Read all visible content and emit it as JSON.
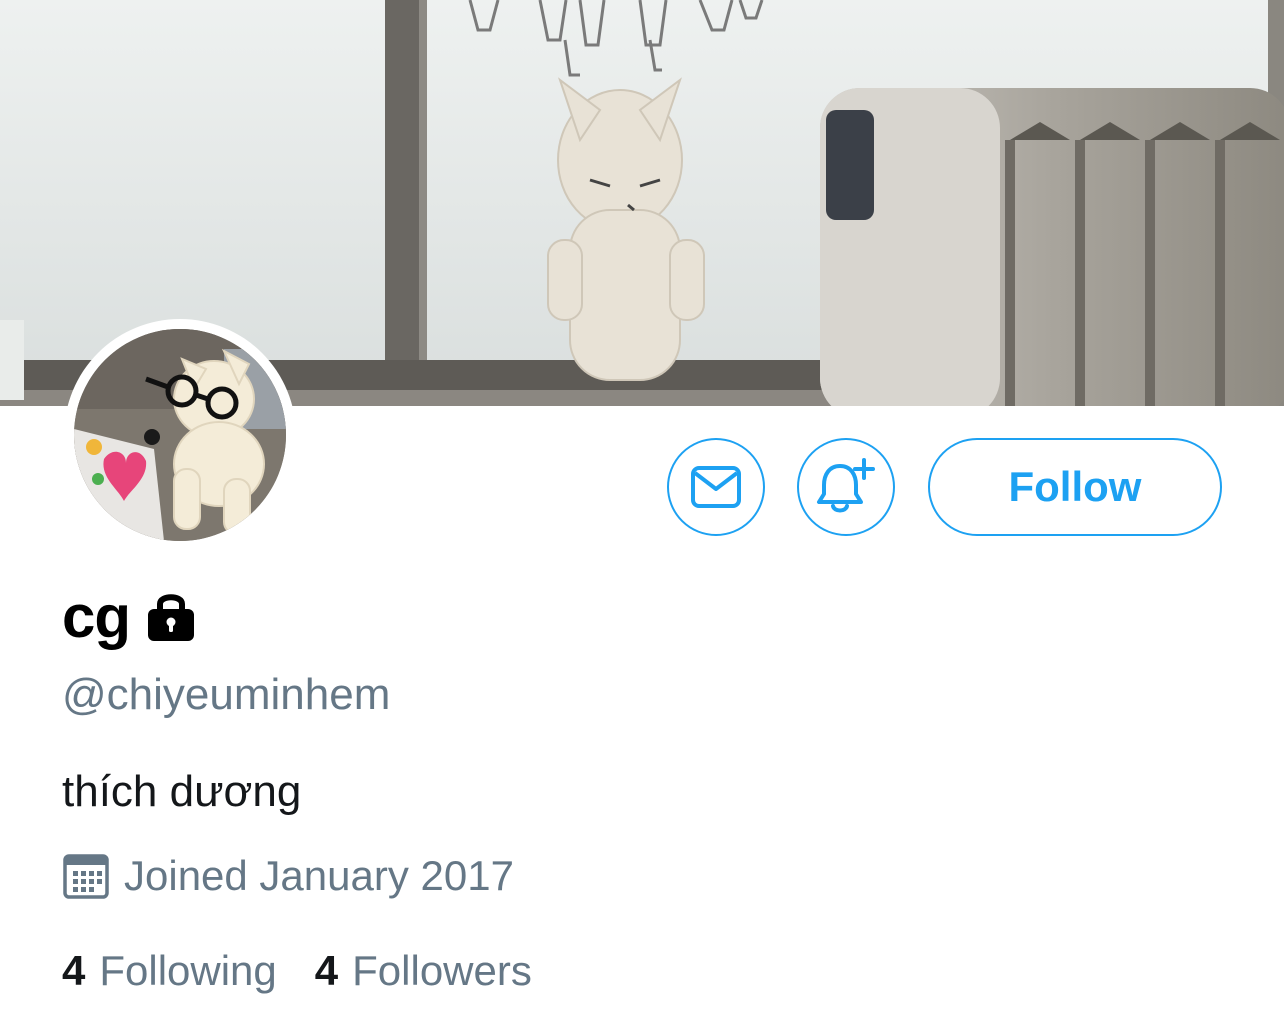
{
  "profile": {
    "display_name": "cg",
    "handle": "@chiyeuminhem",
    "bio": "thích dương",
    "joined": "Joined January 2017",
    "protected": true
  },
  "actions": {
    "message_icon": "envelope-icon",
    "notify_icon": "bell-plus-icon",
    "follow_label": "Follow"
  },
  "stats": {
    "following_count": "4",
    "following_label": "Following",
    "followers_count": "4",
    "followers_label": "Followers"
  },
  "colors": {
    "accent": "#1da1f2",
    "secondary_text": "#657786",
    "primary_text": "#14171a"
  }
}
